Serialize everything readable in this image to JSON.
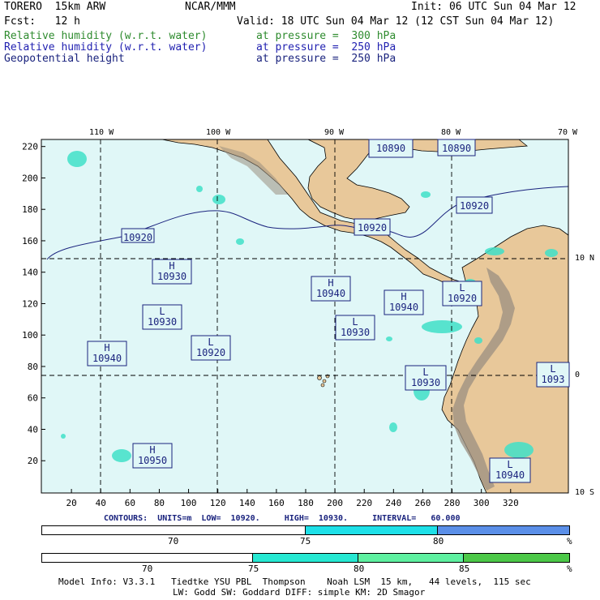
{
  "header": {
    "model": "TORERO  15km ARW",
    "org": "NCAR/MMM",
    "init": "Init: 06 UTC Sun 04 Mar 12",
    "fcst": "Fcst:   12 h",
    "valid": "Valid: 18 UTC Sun 04 Mar 12 (12 CST Sun 04 Mar 12)",
    "fields": [
      {
        "name": "Relative humidity (w.r.t. water)",
        "level": "at pressure =  300 hPa",
        "color": "#2e8b2e"
      },
      {
        "name": "Relative humidity (w.r.t. water)",
        "level": "at pressure =  250 hPa",
        "color": "#1f1fb0"
      },
      {
        "name": "Geopotential height",
        "level": "at pressure =  250 hPa",
        "color": "#1a237e"
      }
    ]
  },
  "map": {
    "lon_labels": [
      "110 W",
      "100 W",
      "90 W",
      "80 W",
      "70 W"
    ],
    "lat_labels": [
      "10 N",
      "0",
      "10 S"
    ],
    "x_ticks": [
      "20",
      "40",
      "60",
      "80",
      "100",
      "120",
      "140",
      "160",
      "180",
      "200",
      "220",
      "240",
      "260",
      "280",
      "300",
      "320"
    ],
    "y_ticks": [
      "220",
      "200",
      "180",
      "160",
      "140",
      "120",
      "100",
      "80",
      "60",
      "40",
      "20"
    ],
    "height_labels": [
      {
        "kind": "",
        "value": "10890"
      },
      {
        "kind": "",
        "value": "10890"
      },
      {
        "kind": "",
        "value": "10920"
      },
      {
        "kind": "",
        "value": "10920"
      },
      {
        "kind": "",
        "value": "10920"
      },
      {
        "kind": "H",
        "value": "10930"
      },
      {
        "kind": "H",
        "value": "10940"
      },
      {
        "kind": "H",
        "value": "10940"
      },
      {
        "kind": "L",
        "value": "10920"
      },
      {
        "kind": "L",
        "value": "10930"
      },
      {
        "kind": "L",
        "value": "10930"
      },
      {
        "kind": "H",
        "value": "10940"
      },
      {
        "kind": "L",
        "value": "10920"
      },
      {
        "kind": "L",
        "value": "10930"
      },
      {
        "kind": "L",
        "value": "1093"
      },
      {
        "kind": "H",
        "value": "10950"
      },
      {
        "kind": "L",
        "value": "10940"
      }
    ],
    "colors": {
      "ocean": "#e0f7f7",
      "land": "#e8c89a",
      "mountain": "#9b8f80",
      "contour": "#1a237e",
      "moisture": "#40e0c8"
    }
  },
  "contours_info": "CONTOURS:  UNITS=m  LOW=  10920.     HIGH=  10930.     INTERVAL=   60.000",
  "colorbar_250": {
    "labels": [
      "70",
      "75",
      "80",
      "%"
    ],
    "colors": [
      "#ffffff",
      "#1ee0e8",
      "#5b8fe8"
    ]
  },
  "colorbar_300": {
    "labels": [
      "70",
      "75",
      "80",
      "85",
      "%"
    ],
    "colors": [
      "#ffffff",
      "#26e8d2",
      "#5ef0a0",
      "#4cc848"
    ]
  },
  "footer": {
    "line1": "Model Info: V3.3.1   Tiedtke YSU PBL  Thompson    Noah LSM  15 km,   44 levels,  115 sec",
    "line2": "LW: Godd SW: Goddard DIFF: simple KM: 2D Smagor"
  }
}
